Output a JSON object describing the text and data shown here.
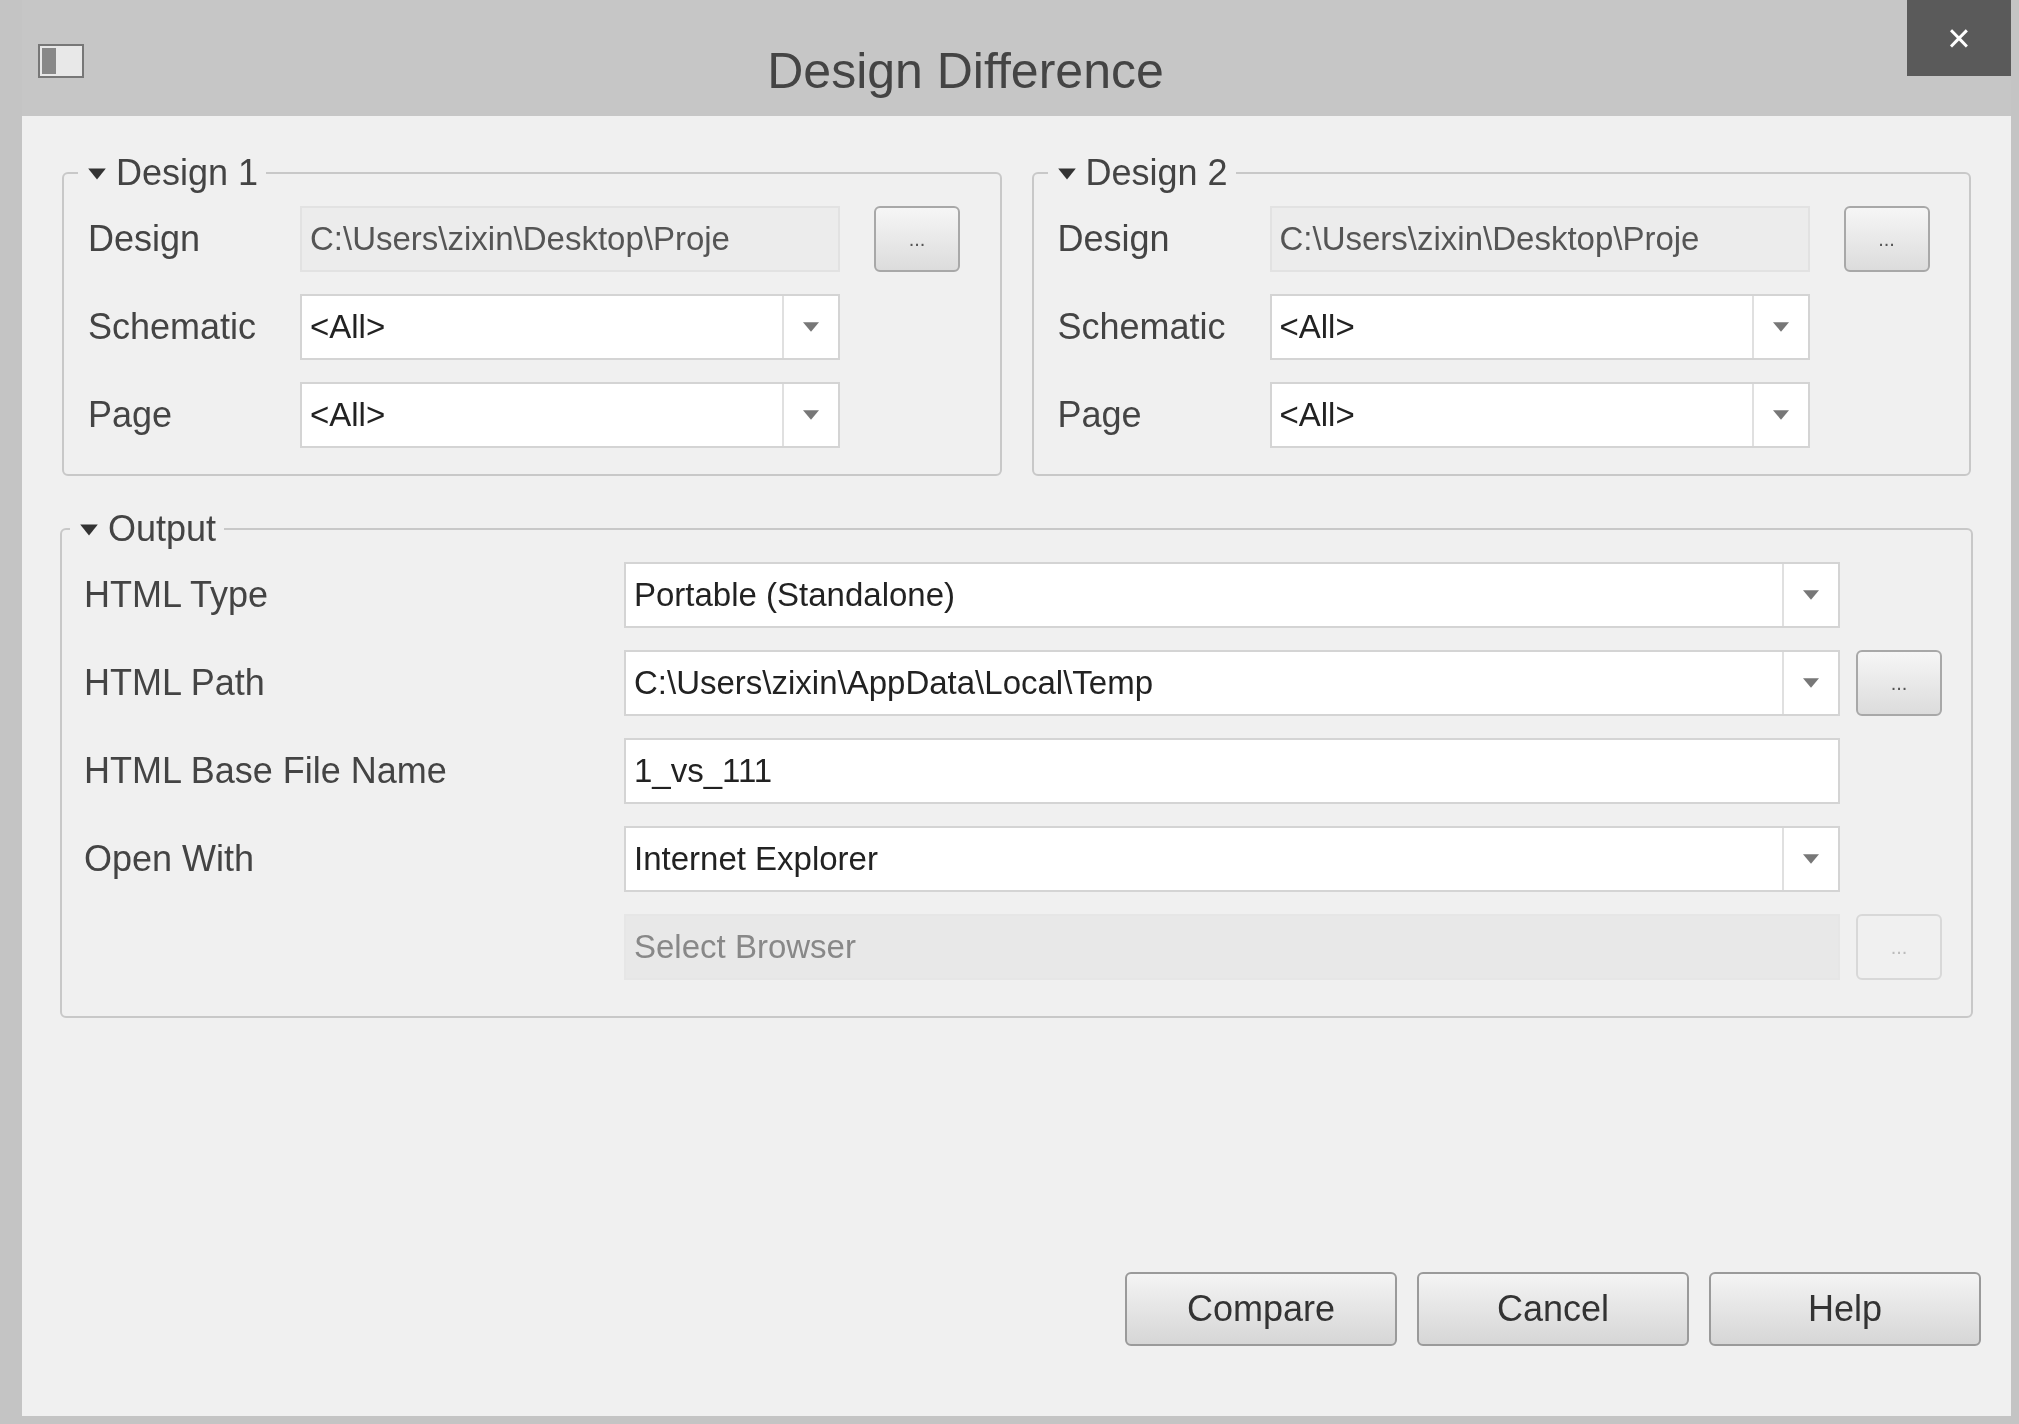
{
  "window": {
    "title": "Design Difference",
    "close": "×"
  },
  "design_groups": [
    {
      "title": "Design 1",
      "expanded": true,
      "fields": [
        {
          "kind": "path",
          "label": "Design",
          "value": "C:\\Users\\zixin\\Desktop\\Proje",
          "browse": "..."
        },
        {
          "kind": "dropdown",
          "label": "Schematic",
          "value": "<All>"
        },
        {
          "kind": "dropdown",
          "label": "Page",
          "value": "<All>"
        }
      ]
    },
    {
      "title": "Design 2",
      "expanded": true,
      "fields": [
        {
          "kind": "path",
          "label": "Design",
          "value": "C:\\Users\\zixin\\Desktop\\Proje",
          "browse": "..."
        },
        {
          "kind": "dropdown",
          "label": "Schematic",
          "value": "<All>"
        },
        {
          "kind": "dropdown",
          "label": "Page",
          "value": "<All>"
        }
      ]
    }
  ],
  "output": {
    "title": "Output",
    "expanded": true,
    "rows": [
      {
        "kind": "dropdown",
        "label": "HTML Type",
        "value": "Portable (Standalone)"
      },
      {
        "kind": "dropdown",
        "label": "HTML Path",
        "value": "C:\\Users\\zixin\\AppData\\Local\\Temp",
        "browse": "..."
      },
      {
        "kind": "text",
        "label": "HTML Base File Name",
        "value": "1_vs_111"
      },
      {
        "kind": "dropdown",
        "label": "Open With",
        "value": "Internet Explorer"
      },
      {
        "kind": "text",
        "placeholder": "Select Browser",
        "disabled": true,
        "browse": "...",
        "browse_disabled": true
      }
    ]
  },
  "buttons": [
    "Compare",
    "Cancel",
    "Help"
  ]
}
